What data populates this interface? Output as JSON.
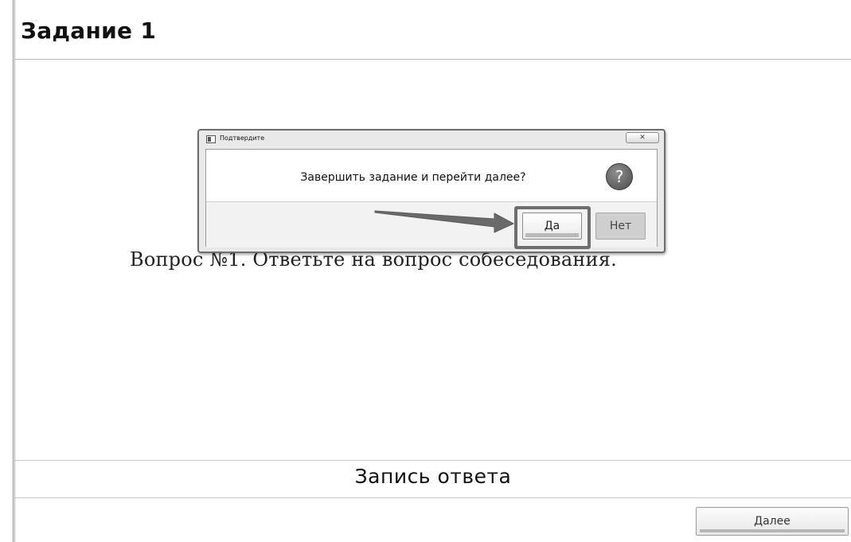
{
  "page": {
    "title": "Задание 1",
    "question": "Вопрос №1. Ответьте на вопрос собеседования."
  },
  "recording": {
    "label": "Запись ответа"
  },
  "footer": {
    "next_label": "Далее"
  },
  "dialog": {
    "title": "Подтвердите",
    "close_glyph": "✕",
    "message": "Завершить задание и перейти далее?",
    "icon": "question-icon",
    "icon_glyph": "?",
    "yes_label": "Да",
    "no_label": "Нет",
    "highlighted_button": "yes"
  },
  "colors": {
    "background": "#ffffff",
    "highlight_border": "#6e6e6e",
    "arrow": "#6a6a6a"
  }
}
